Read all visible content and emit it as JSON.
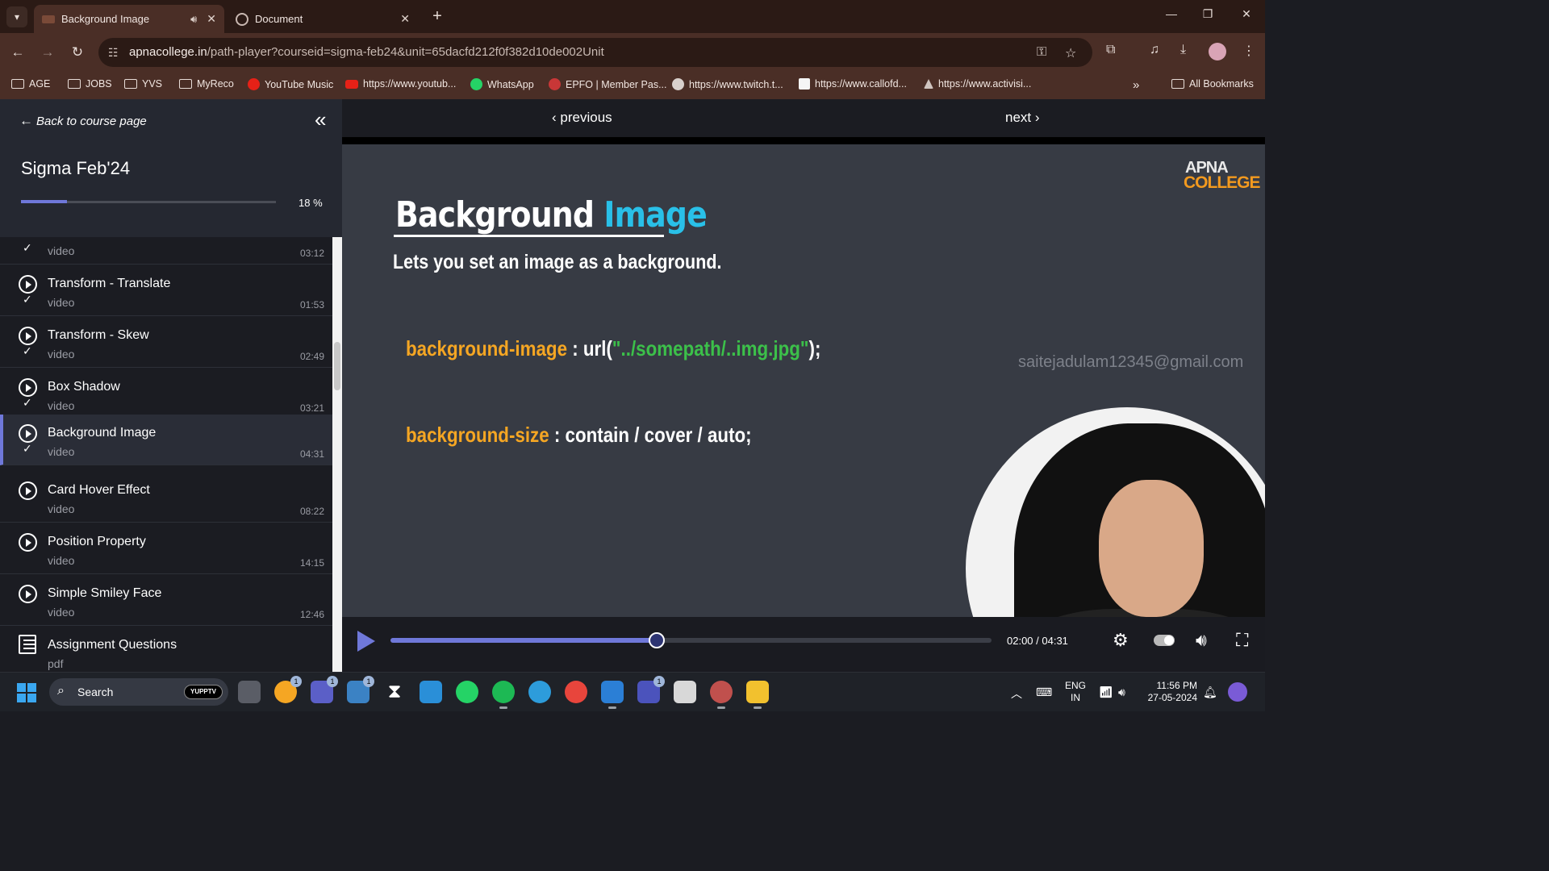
{
  "browser": {
    "tabs": [
      {
        "title": "Background Image",
        "active": true
      },
      {
        "title": "Document",
        "active": false
      }
    ],
    "url_host": "apnacollege.in",
    "url_path": "/path-player?courseid=sigma-feb24&unit=65dacfd212f0f382d10de002Unit",
    "bookmarks": [
      {
        "label": "AGE",
        "icon": "folder-icon"
      },
      {
        "label": "JOBS",
        "icon": "folder-icon"
      },
      {
        "label": "YVS",
        "icon": "folder-icon"
      },
      {
        "label": "MyReco",
        "icon": "folder-icon"
      },
      {
        "label": "YouTube Music",
        "icon": "youtube-music-icon"
      },
      {
        "label": "https://www.youtub...",
        "icon": "youtube-icon"
      },
      {
        "label": "WhatsApp",
        "icon": "whatsapp-icon"
      },
      {
        "label": "EPFO | Member Pas...",
        "icon": "epfo-icon"
      },
      {
        "label": "https://www.twitch.t...",
        "icon": "globe-icon"
      },
      {
        "label": "https://www.callofd...",
        "icon": "callofduty-icon"
      },
      {
        "label": "https://www.activisi...",
        "icon": "activision-icon"
      }
    ],
    "all_bookmarks": "All Bookmarks"
  },
  "sidebar": {
    "back_label": "Back to course page",
    "course_title": "Sigma Feb'24",
    "progress_percent": 18,
    "progress_label": "18 %",
    "lessons": [
      {
        "title": "",
        "type": "video",
        "duration": "03:12",
        "completed": true
      },
      {
        "title": "Transform - Translate",
        "type": "video",
        "duration": "01:53",
        "completed": true
      },
      {
        "title": "Transform - Skew",
        "type": "video",
        "duration": "02:49",
        "completed": true
      },
      {
        "title": "Box Shadow",
        "type": "video",
        "duration": "03:21",
        "completed": true
      },
      {
        "title": "Background Image",
        "type": "video",
        "duration": "04:31",
        "completed": true,
        "selected": true
      },
      {
        "title": "Card Hover Effect",
        "type": "video",
        "duration": "08:22",
        "completed": false
      },
      {
        "title": "Position Property",
        "type": "video",
        "duration": "14:15",
        "completed": false
      },
      {
        "title": "Simple Smiley Face",
        "type": "video",
        "duration": "12:46",
        "completed": false
      },
      {
        "title": "Assignment Questions",
        "type": "pdf",
        "duration": "",
        "completed": false
      }
    ]
  },
  "player": {
    "prev_label": "previous",
    "next_label": "next",
    "slide": {
      "title_part1": "Background ",
      "title_part2": "Image",
      "subtitle": "Lets you set an image as a background.",
      "line1_prop": "background-image",
      "line1_mid": " : url(",
      "line1_str": "\"../somepath/..img.jpg\"",
      "line1_end": ");",
      "line2_prop": "background-size",
      "line2_rest": " : contain / cover / auto;",
      "watermark": "saitejadulam12345@gmail.com",
      "logo_line1": "APNA",
      "logo_line2": "COLLEGE"
    },
    "elapsed": "02:00",
    "duration": "04:31",
    "time_label": "02:00 / 04:31",
    "played_fraction": 0.443
  },
  "taskbar": {
    "search_label": "Search",
    "search_badge": "YUPPTV",
    "lang_line1": "ENG",
    "lang_line2": "IN",
    "time": "11:56 PM",
    "date": "27-05-2024"
  },
  "colors": {
    "accent": "#6f78d9",
    "title_accent": "#29c0e8",
    "css_prop": "#f5a623",
    "css_string": "#3cc04a"
  }
}
